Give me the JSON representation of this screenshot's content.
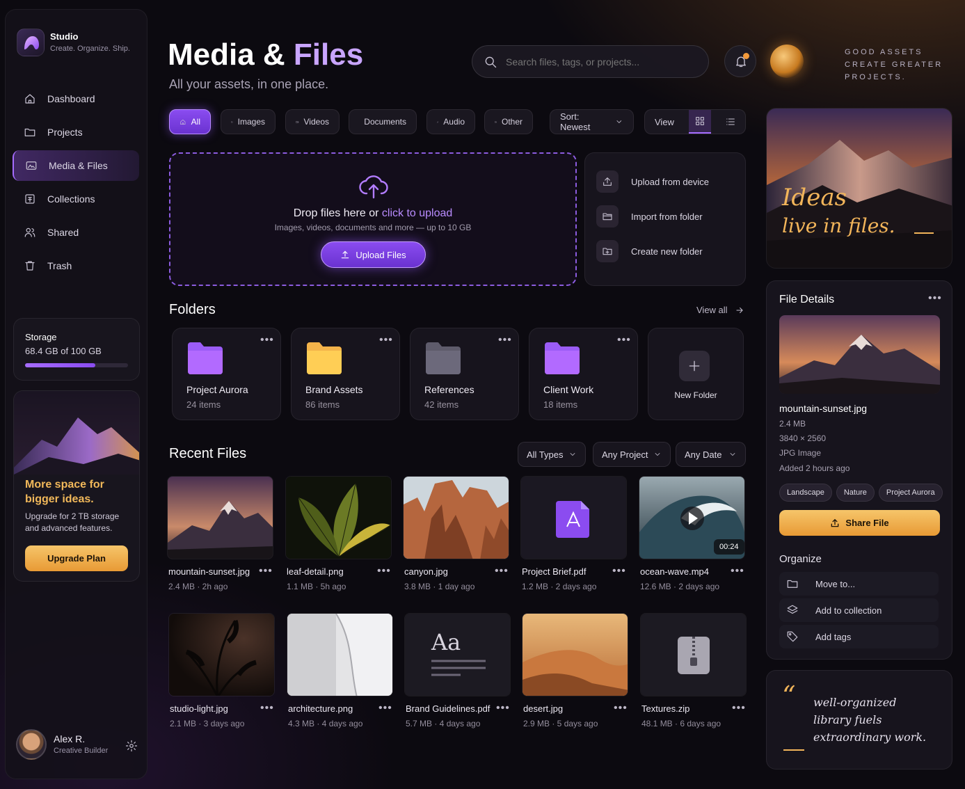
{
  "app": {
    "name": "Studio",
    "tagline": "Create. Organize. Ship."
  },
  "nav": [
    {
      "label": "Dashboard",
      "icon": "home-icon"
    },
    {
      "label": "Projects",
      "icon": "folder-icon"
    },
    {
      "label": "Media & Files",
      "icon": "media-icon",
      "active": true
    },
    {
      "label": "Collections",
      "icon": "collection-icon"
    },
    {
      "label": "Shared",
      "icon": "users-icon"
    },
    {
      "label": "Trash",
      "icon": "trash-icon"
    }
  ],
  "storage": {
    "title": "Storage",
    "used_text": "68.4 GB of 100 GB",
    "fraction": 0.684
  },
  "promo": {
    "title": "More space for bigger ideas.",
    "text": "Upgrade for 2 TB storage and advanced features.",
    "button": "Upgrade Plan"
  },
  "user": {
    "name": "Alex R.",
    "role": "Creative Builder"
  },
  "header": {
    "title_a": "Media & ",
    "title_b": "Files",
    "subtitle": "All your assets, in one place.",
    "search_placeholder": "Search files, tags, or projects...",
    "motto": "GOOD ASSETS CREATE GREATER PROJECTS."
  },
  "filters": [
    {
      "label": "All",
      "icon": "home-icon",
      "active": true
    },
    {
      "label": "Images",
      "icon": "image-icon"
    },
    {
      "label": "Videos",
      "icon": "video-icon"
    },
    {
      "label": "Documents",
      "icon": "document-icon"
    },
    {
      "label": "Audio",
      "icon": "music-icon"
    },
    {
      "label": "Other",
      "icon": "box-icon"
    }
  ],
  "sort": {
    "label": "Sort: Newest"
  },
  "view": {
    "label": "View",
    "mode": "grid"
  },
  "upload": {
    "title_a": "Drop files here or ",
    "title_b": "click to upload",
    "hint": "Images, videos, documents and more — up to 10 GB",
    "button": "Upload Files"
  },
  "upload_actions": [
    {
      "label": "Upload from device",
      "icon": "upload-icon"
    },
    {
      "label": "Import from folder",
      "icon": "folder-open-icon"
    },
    {
      "label": "Create new folder",
      "icon": "folder-plus-icon"
    }
  ],
  "folders_section": {
    "title": "Folders",
    "view_all": "View all"
  },
  "folders": [
    {
      "name": "Project Aurora",
      "count": "24 items",
      "color": "#9b5cf6"
    },
    {
      "name": "Brand Assets",
      "count": "86 items",
      "color": "#f3b34a"
    },
    {
      "name": "References",
      "count": "42 items",
      "color": "#5e5b6b"
    },
    {
      "name": "Client Work",
      "count": "18 items",
      "color": "#9b5cf6"
    }
  ],
  "new_folder": "New Folder",
  "recent": {
    "title": "Recent Files",
    "filters": [
      "All Types",
      "Any Project",
      "Any Date"
    ]
  },
  "files": [
    {
      "name": "mountain-sunset.jpg",
      "meta": "2.4 MB · 2h ago",
      "kind": "mountain"
    },
    {
      "name": "leaf-detail.png",
      "meta": "1.1 MB · 5h ago",
      "kind": "leaf"
    },
    {
      "name": "canyon.jpg",
      "meta": "3.8 MB · 1 day ago",
      "kind": "canyon"
    },
    {
      "name": "Project Brief.pdf",
      "meta": "1.2 MB · 2 days ago",
      "kind": "pdf"
    },
    {
      "name": "ocean-wave.mp4",
      "meta": "12.6 MB · 2 days ago",
      "kind": "wave",
      "duration": "00:24"
    },
    {
      "name": "studio-light.jpg",
      "meta": "2.1 MB · 3 days ago",
      "kind": "plant"
    },
    {
      "name": "architecture.png",
      "meta": "4.3 MB · 4 days ago",
      "kind": "arch"
    },
    {
      "name": "Brand Guidelines.pdf",
      "meta": "5.7 MB · 4 days ago",
      "kind": "font",
      "glyph": "Aa"
    },
    {
      "name": "desert.jpg",
      "meta": "2.9 MB · 5 days ago",
      "kind": "desert"
    },
    {
      "name": "Textures.zip",
      "meta": "48.1 MB · 6 days ago",
      "kind": "zip"
    }
  ],
  "hero": {
    "text_a": "Ideas",
    "text_b": "live in files."
  },
  "details": {
    "title": "File Details",
    "name": "mountain-sunset.jpg",
    "size": "2.4 MB",
    "dims": "3840 × 2560",
    "type": "JPG Image",
    "added": "Added 2 hours ago",
    "tags": [
      "Landscape",
      "Nature",
      "Project Aurora"
    ],
    "share": "Share File"
  },
  "organize": {
    "title": "Organize",
    "items": [
      {
        "label": "Move to...",
        "icon": "folder-icon"
      },
      {
        "label": "Add to collection",
        "icon": "layers-icon"
      },
      {
        "label": "Add tags",
        "icon": "tag-icon"
      }
    ]
  },
  "quote": {
    "mark": "“",
    "lines": [
      "well-organized",
      "library fuels",
      "extraordinary work."
    ]
  },
  "colors": {
    "accent": "#9b5cf6",
    "gold": "#f3b34a",
    "bg": "#0c0a10"
  }
}
